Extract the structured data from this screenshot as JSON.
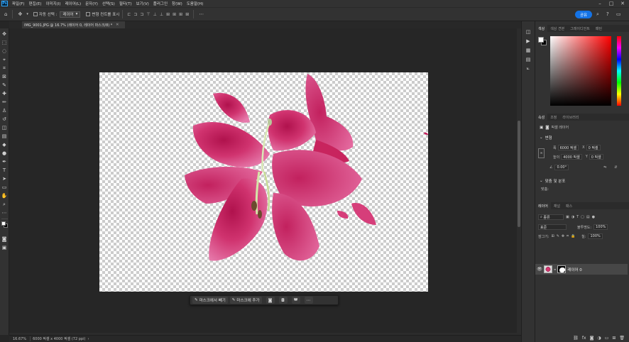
{
  "menubar": {
    "logo": "Ps",
    "items": [
      "파일(F)",
      "편집(E)",
      "이미지(I)",
      "레이어(L)",
      "문자(Y)",
      "선택(S)",
      "필터(T)",
      "보기(V)",
      "플러그인",
      "창(W)",
      "도움말(H)"
    ]
  },
  "options": {
    "auto_select_label": "자동 선택 :",
    "auto_select_value": "레이어",
    "transform_controls_label": "변형 컨트롤 표시",
    "share_label": "공유"
  },
  "document": {
    "tab_title": "IMG_9001.JPG @ 16.7% (레이어 0, 레이어 마스크/8) *"
  },
  "context_bar": {
    "subtract_label": "마스크에서 빼기",
    "add_label": "마스크에 추가"
  },
  "status": {
    "zoom": "16.67%",
    "info": "6000 픽셀 x 4000 픽셀 (72 ppi)"
  },
  "color_panel": {
    "tabs": [
      "색상",
      "색상 견본",
      "그레이디언트",
      "패턴"
    ]
  },
  "properties_panel": {
    "tabs": [
      "속성",
      "조정",
      "라이브러리"
    ],
    "layer_kind": "픽셀 레이어",
    "transform_label": "변형",
    "w_label": "폭",
    "w_value": "6000 픽셀",
    "x_label": "X",
    "x_value": "0 픽셀",
    "h_label": "높이",
    "h_value": "4000 픽셀",
    "y_label": "Y",
    "y_value": "0 픽셀",
    "angle_value": "0.00°",
    "align_label": "맞춤 및 분포",
    "align_sub": "맞춤:"
  },
  "layers_panel": {
    "tabs": [
      "레이어",
      "채널",
      "패스"
    ],
    "filter_value": "종류",
    "blend_mode": "표준",
    "opacity_label": "불투명도:",
    "opacity_value": "100%",
    "lock_label": "잠그기:",
    "fill_label": "칠:",
    "fill_value": "100%",
    "layer_name": "레이어 0"
  },
  "colors": {
    "accent": "#1473e6",
    "flower_main": "#c81e5c",
    "flower_light": "#e0609a"
  }
}
